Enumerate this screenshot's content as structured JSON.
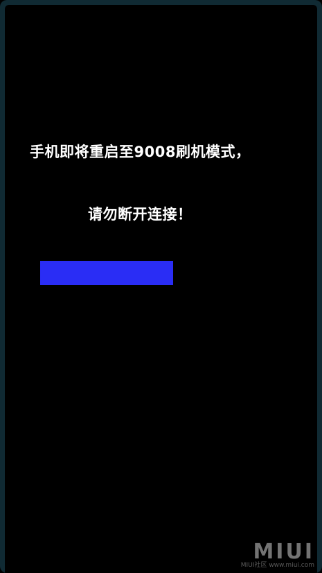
{
  "screen": {
    "message_line1": "手机即将重启至9008刷机模式，",
    "message_line2": "请勿断开连接！"
  },
  "progress": {
    "fraction": 0.55,
    "color": "#2a2df5"
  },
  "watermark": {
    "logo": "MIUI",
    "sub": "MIUI社区 www.miui.com"
  },
  "colors": {
    "background": "#000000",
    "frame": "#102a33",
    "text": "#ffffff"
  }
}
